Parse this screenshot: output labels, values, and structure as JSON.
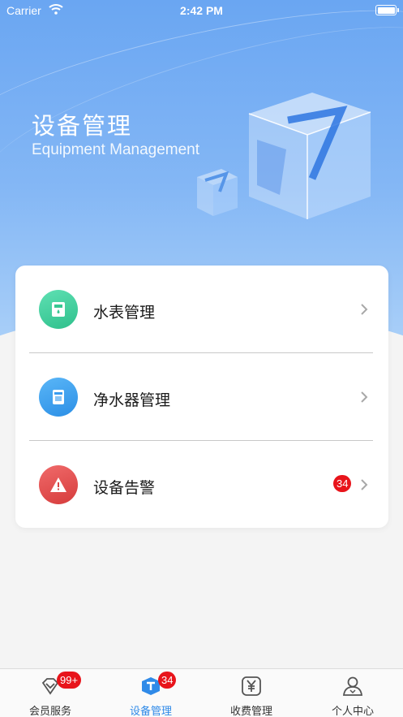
{
  "status_bar": {
    "carrier": "Carrier",
    "time": "2:42 PM"
  },
  "header": {
    "title": "设备管理",
    "subtitle": "Equipment Management"
  },
  "menu": {
    "items": [
      {
        "label": "水表管理",
        "icon": "water-meter-icon",
        "color": "#3fcf9c"
      },
      {
        "label": "净水器管理",
        "icon": "water-purifier-icon",
        "color": "#3aa0f0"
      },
      {
        "label": "设备告警",
        "icon": "warning-icon",
        "color": "#e04848",
        "badge": "34"
      }
    ]
  },
  "tabbar": {
    "tabs": [
      {
        "label": "会员服务",
        "icon": "diamond-icon",
        "badge": "99+",
        "active": false
      },
      {
        "label": "设备管理",
        "icon": "cube-icon",
        "badge": "34",
        "active": true
      },
      {
        "label": "收费管理",
        "icon": "yen-icon",
        "active": false
      },
      {
        "label": "个人中心",
        "icon": "person-icon",
        "active": false
      }
    ]
  },
  "colors": {
    "accent": "#2f8ae8",
    "badge": "#e8141b",
    "hero_top": "#6aa6f2"
  }
}
